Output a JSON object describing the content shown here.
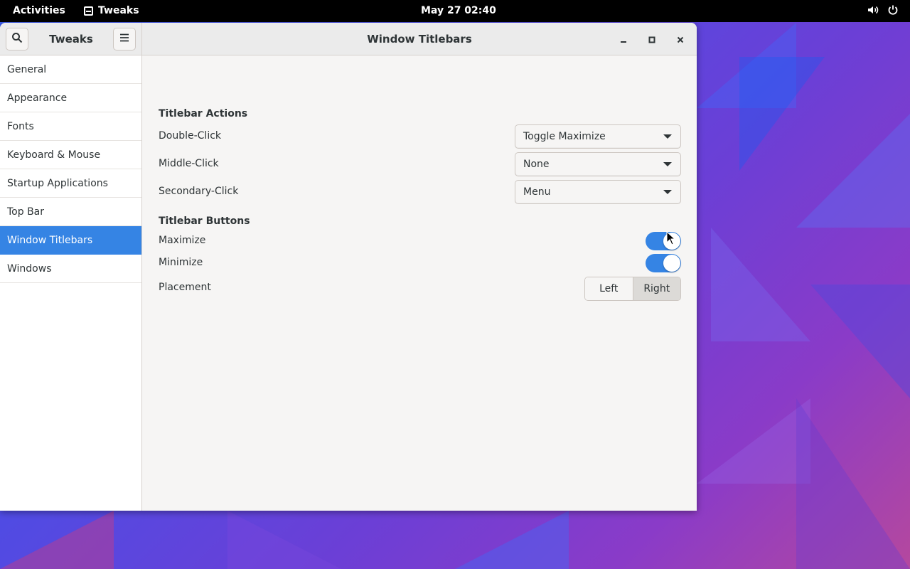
{
  "topbar": {
    "activities": "Activities",
    "app_name": "Tweaks",
    "clock": "May 27  02:40",
    "tray_icons": [
      "volume-icon",
      "power-icon"
    ]
  },
  "window": {
    "sidebar_title": "Tweaks",
    "title": "Window Titlebars",
    "header_icons": [
      "search-icon",
      "menu-icon",
      "minimize-icon",
      "maximize-icon",
      "close-icon"
    ]
  },
  "sidebar": {
    "items": [
      {
        "label": "General"
      },
      {
        "label": "Appearance"
      },
      {
        "label": "Fonts"
      },
      {
        "label": "Keyboard & Mouse"
      },
      {
        "label": "Startup Applications"
      },
      {
        "label": "Top Bar"
      },
      {
        "label": "Window Titlebars",
        "selected": true
      },
      {
        "label": "Windows"
      }
    ]
  },
  "content": {
    "actions_title": "Titlebar Actions",
    "double_click": {
      "label": "Double-Click",
      "value": "Toggle Maximize"
    },
    "middle_click": {
      "label": "Middle-Click",
      "value": "None"
    },
    "secondary_click": {
      "label": "Secondary-Click",
      "value": "Menu"
    },
    "buttons_title": "Titlebar Buttons",
    "maximize": {
      "label": "Maximize",
      "on": true
    },
    "minimize": {
      "label": "Minimize",
      "on": true
    },
    "placement": {
      "label": "Placement",
      "left": "Left",
      "right": "Right",
      "selected": "Right"
    }
  },
  "colors": {
    "accent": "#3584e4",
    "topbar": "#000000",
    "window_bg": "#f6f5f4"
  }
}
